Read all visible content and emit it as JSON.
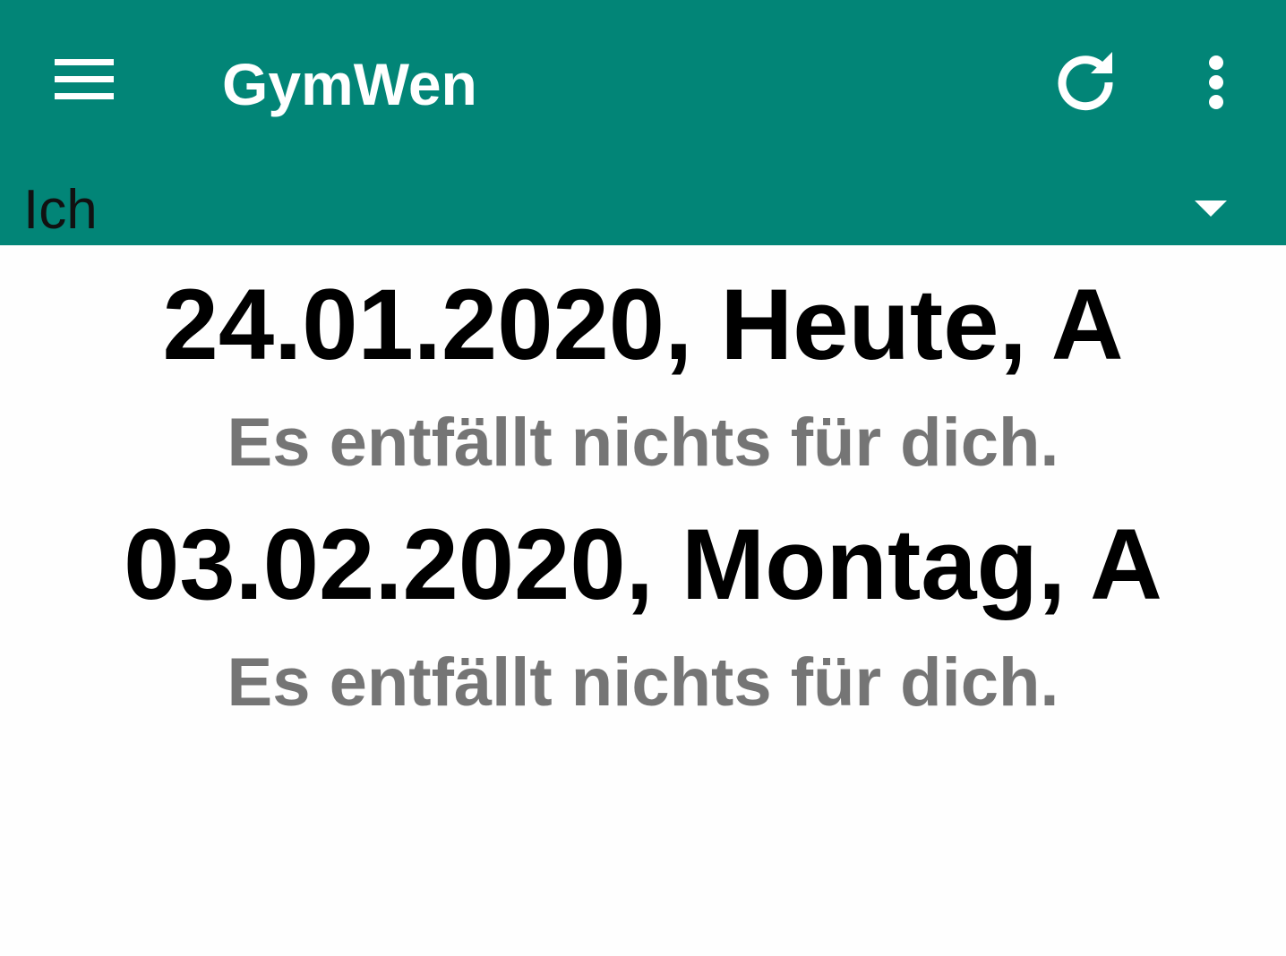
{
  "appbar": {
    "title": "GymWen",
    "background_color": "#028577",
    "icons": [
      "menu-icon",
      "refresh-icon",
      "more-vert-icon"
    ]
  },
  "selector": {
    "value": "Ich",
    "icon": "dropdown-arrow-icon"
  },
  "days": [
    {
      "heading": "24.01.2020, Heute, A",
      "message": "Es entfällt nichts für dich."
    },
    {
      "heading": "03.02.2020, Montag, A",
      "message": "Es entfällt nichts für dich."
    }
  ]
}
